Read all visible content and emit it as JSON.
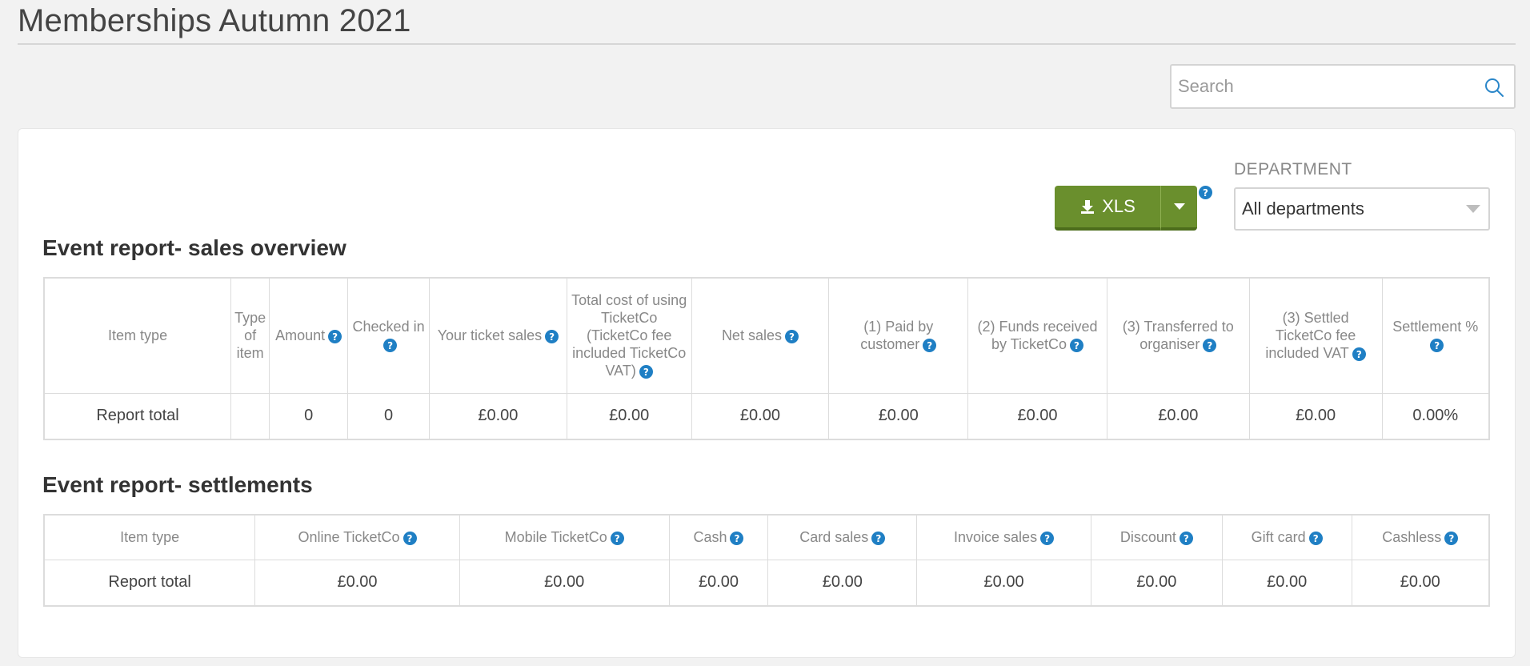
{
  "page": {
    "title": "Memberships Autumn 2021"
  },
  "search": {
    "placeholder": "Search",
    "value": ""
  },
  "toolbar": {
    "xls_label": "XLS",
    "department_label": "DEPARTMENT",
    "department_selected": "All departments"
  },
  "colors": {
    "accent_green": "#6a8f2d",
    "help_blue": "#1f7fc4"
  },
  "sales_overview": {
    "title": "Event report- sales overview",
    "headers": [
      {
        "label": "Item type",
        "help": false
      },
      {
        "label": "Type of item",
        "help": false
      },
      {
        "label": "Amount",
        "help": true
      },
      {
        "label": "Checked in",
        "help": true
      },
      {
        "label": "Your ticket sales",
        "help": true
      },
      {
        "label": "Total cost of using TicketCo (TicketCo fee included TicketCo VAT)",
        "help": true
      },
      {
        "label": "Net sales",
        "help": true
      },
      {
        "label": "(1) Paid by customer",
        "help": true
      },
      {
        "label": "(2) Funds received by TicketCo",
        "help": true
      },
      {
        "label": "(3) Transferred to organiser",
        "help": true
      },
      {
        "label": "(3) Settled TicketCo fee included VAT",
        "help": true
      },
      {
        "label": "Settlement %",
        "help": true
      }
    ],
    "rows": [
      [
        "Report total",
        "",
        "0",
        "0",
        "£0.00",
        "£0.00",
        "£0.00",
        "£0.00",
        "£0.00",
        "£0.00",
        "£0.00",
        "0.00%"
      ]
    ]
  },
  "settlements": {
    "title": "Event report- settlements",
    "headers": [
      {
        "label": "Item type",
        "help": false
      },
      {
        "label": "Online TicketCo",
        "help": true
      },
      {
        "label": "Mobile TicketCo",
        "help": true
      },
      {
        "label": "Cash",
        "help": true
      },
      {
        "label": "Card sales",
        "help": true
      },
      {
        "label": "Invoice sales",
        "help": true
      },
      {
        "label": "Discount",
        "help": true
      },
      {
        "label": "Gift card",
        "help": true
      },
      {
        "label": "Cashless",
        "help": true
      }
    ],
    "rows": [
      [
        "Report total",
        "£0.00",
        "£0.00",
        "£0.00",
        "£0.00",
        "£0.00",
        "£0.00",
        "£0.00",
        "£0.00"
      ]
    ]
  }
}
